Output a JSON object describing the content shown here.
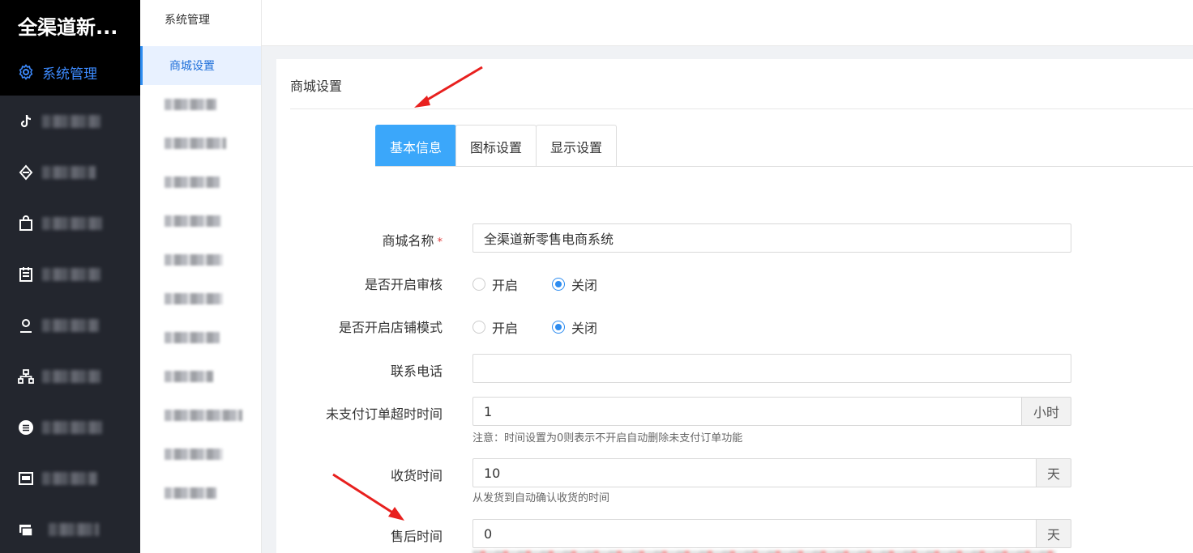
{
  "app": {
    "title": "全渠道新..."
  },
  "sidebar": {
    "items": [
      {
        "label": "系统管理",
        "icon": "gear-icon",
        "active": true
      },
      {
        "label": "",
        "icon": "tiktok-icon"
      },
      {
        "label": "",
        "icon": "diamond-icon"
      },
      {
        "label": "",
        "icon": "bag-icon"
      },
      {
        "label": "",
        "icon": "order-icon"
      },
      {
        "label": "",
        "icon": "user-icon"
      },
      {
        "label": "",
        "icon": "hierarchy-icon"
      },
      {
        "label": "",
        "icon": "circle-menu-icon"
      },
      {
        "label": "",
        "icon": "card-icon"
      },
      {
        "label": "",
        "icon": "stack-icon"
      }
    ]
  },
  "submenu": {
    "title": "系统管理",
    "items": [
      {
        "label": "商城设置",
        "active": true
      },
      {
        "label": ""
      },
      {
        "label": ""
      },
      {
        "label": ""
      },
      {
        "label": ""
      },
      {
        "label": ""
      },
      {
        "label": ""
      },
      {
        "label": ""
      },
      {
        "label": ""
      },
      {
        "label": ""
      },
      {
        "label": ""
      },
      {
        "label": ""
      }
    ]
  },
  "panel": {
    "title": "商城设置"
  },
  "tabs": [
    {
      "label": "基本信息",
      "active": true
    },
    {
      "label": "图标设置"
    },
    {
      "label": "显示设置"
    }
  ],
  "form": {
    "shop_name": {
      "label": "商城名称",
      "required_mark": "*",
      "value": "全渠道新零售电商系统"
    },
    "audit": {
      "label": "是否开启审核",
      "options": [
        "开启",
        "关闭"
      ],
      "selected": "关闭"
    },
    "store_mode": {
      "label": "是否开启店铺模式",
      "options": [
        "开启",
        "关闭"
      ],
      "selected": "关闭"
    },
    "phone": {
      "label": "联系电话",
      "value": ""
    },
    "unpaid_timeout": {
      "label": "未支付订单超时时间",
      "value": "1",
      "unit": "小时",
      "hint": "注意：时间设置为0则表示不开启自动删除未支付订单功能"
    },
    "receive_time": {
      "label": "收货时间",
      "value": "10",
      "unit": "天",
      "hint": "从发货到自动确认收货的时间"
    },
    "after_sale_time": {
      "label": "售后时间",
      "value": "0",
      "unit": "天"
    }
  },
  "colors": {
    "accent": "#3ba7fa",
    "active_blue": "#2d8cf0",
    "sidebar_bg": "#23262e",
    "annotation_arrow": "#e8201e"
  }
}
